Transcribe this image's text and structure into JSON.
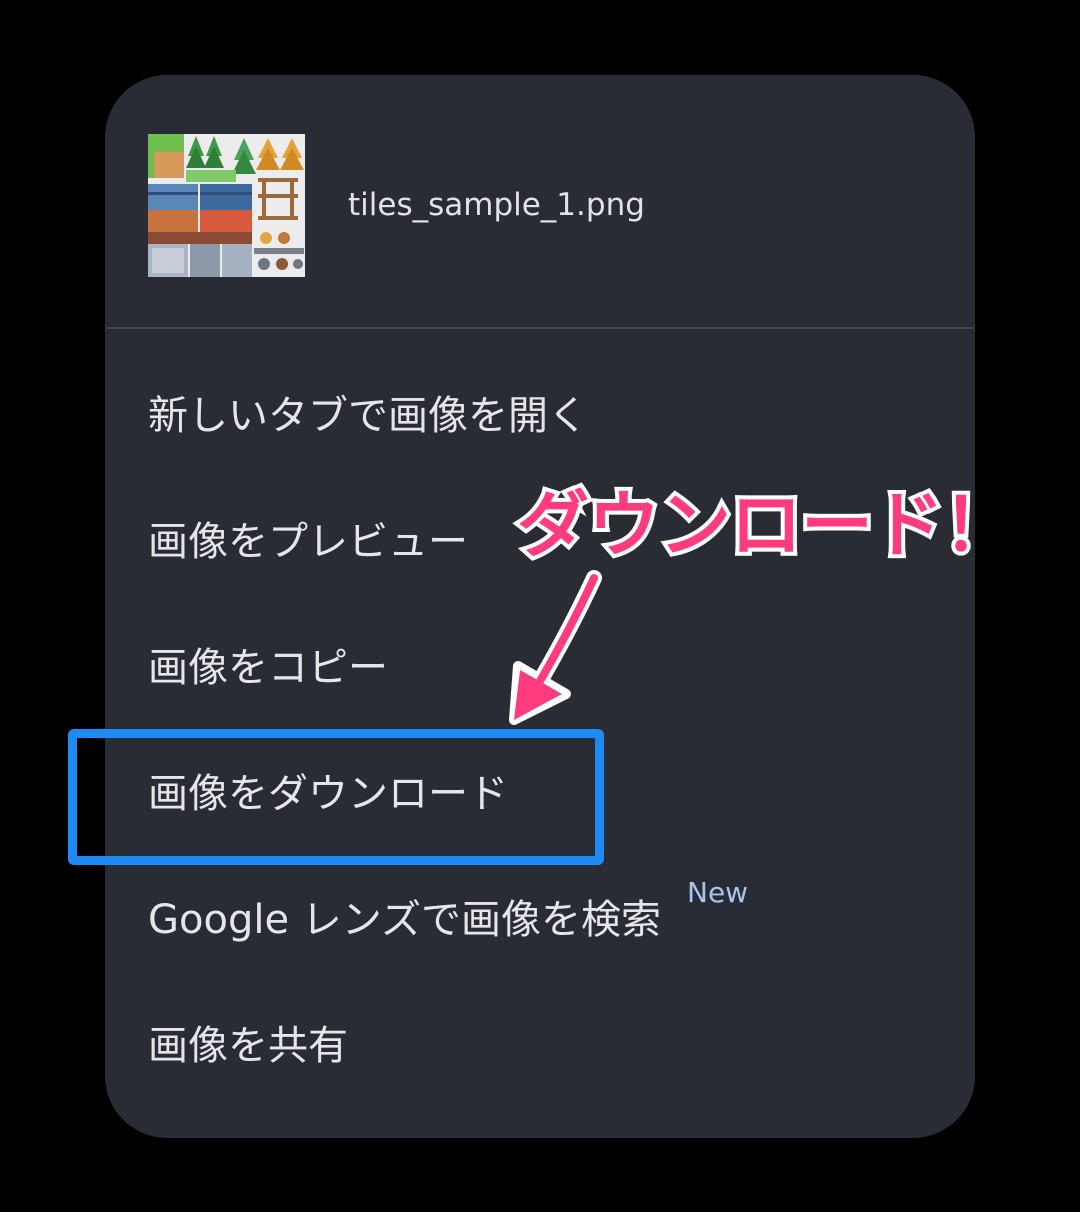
{
  "header": {
    "file_name": "tiles_sample_1.png",
    "thumbnail_icon": "tileset-thumbnail-icon"
  },
  "menu": {
    "items": [
      {
        "label": "新しいタブで画像を開く"
      },
      {
        "label": "画像をプレビュー"
      },
      {
        "label": "画像をコピー"
      },
      {
        "label": "画像をダウンロード"
      },
      {
        "label": "Google レンズで画像を検索",
        "badge": "New"
      },
      {
        "label": "画像を共有"
      }
    ]
  },
  "annotation": {
    "callout_text": "ダウンロード！",
    "callout_color": "#ff3b7f",
    "highlight_color": "#1e8af5",
    "arrow_icon": "arrow-down-left-icon"
  },
  "colors": {
    "page_background": "#000000",
    "menu_background": "#292c34",
    "text": "#e6e6ea",
    "badge": "#a8c4f0"
  }
}
